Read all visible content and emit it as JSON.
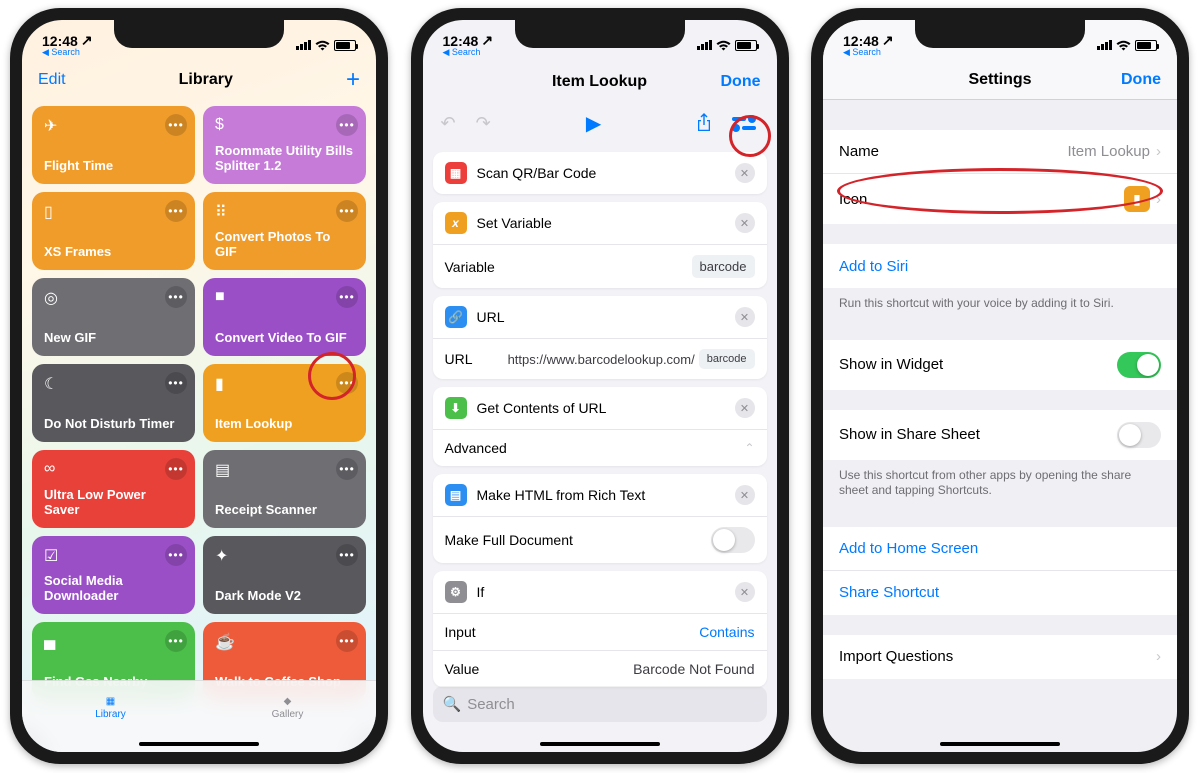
{
  "status": {
    "time": "12:48",
    "back_app": "Search"
  },
  "phone1": {
    "nav_edit": "Edit",
    "nav_title": "Library",
    "tiles": [
      {
        "title": "Flight Time",
        "color": "#f09c2a",
        "icon": "airplane"
      },
      {
        "title": "Roommate Utility Bills Splitter 1.2",
        "color": "#c67bd9",
        "icon": "dollar"
      },
      {
        "title": "XS Frames",
        "color": "#f09c2a",
        "icon": "phone"
      },
      {
        "title": "Convert Photos To GIF",
        "color": "#f09c2a",
        "icon": "grid"
      },
      {
        "title": "New GIF",
        "color": "#6e6e73",
        "icon": "target"
      },
      {
        "title": "Convert Video To GIF",
        "color": "#9a4fc7",
        "icon": "video"
      },
      {
        "title": "Do Not Disturb Timer",
        "color": "#58585d",
        "icon": "moon"
      },
      {
        "title": "Item Lookup",
        "color": "#f0a020",
        "icon": "barcode"
      },
      {
        "title": "Ultra Low Power Saver",
        "color": "#e7413a",
        "icon": "infinity"
      },
      {
        "title": "Receipt Scanner",
        "color": "#6e6e73",
        "icon": "document"
      },
      {
        "title": "Social Media Downloader",
        "color": "#9a4fc7",
        "icon": "checkbox"
      },
      {
        "title": "Dark Mode V2",
        "color": "#58585d",
        "icon": "wand"
      },
      {
        "title": "Find Gas Nearby",
        "color": "#4cbf4a",
        "icon": "car"
      },
      {
        "title": "Walk to Coffee Shop",
        "color": "#ee5b3a",
        "icon": "cup"
      }
    ],
    "tab_library": "Library",
    "tab_gallery": "Gallery"
  },
  "phone2": {
    "nav_title": "Item Lookup",
    "nav_done": "Done",
    "actions": {
      "scan": "Scan QR/Bar Code",
      "setvar": "Set Variable",
      "setvar_label": "Variable",
      "setvar_value": "barcode",
      "url": "URL",
      "url_label": "URL",
      "url_value": "https://www.barcodelookup.com/",
      "url_var": "barcode",
      "get_contents": "Get Contents of URL",
      "advanced": "Advanced",
      "make_html": "Make HTML from Rich Text",
      "make_full": "Make Full Document",
      "if": "If",
      "if_input": "Input",
      "if_cond": "Contains",
      "if_value_label": "Value",
      "if_value": "Barcode Not Found"
    },
    "search_placeholder": "Search"
  },
  "phone3": {
    "nav_title": "Settings",
    "nav_done": "Done",
    "name_label": "Name",
    "name_value": "Item Lookup",
    "icon_label": "Icon",
    "add_siri": "Add to Siri",
    "siri_hint": "Run this shortcut with your voice by adding it to Siri.",
    "show_widget": "Show in Widget",
    "show_share": "Show in Share Sheet",
    "share_hint": "Use this shortcut from other apps by opening the share sheet and tapping Shortcuts.",
    "add_home": "Add to Home Screen",
    "share_shortcut": "Share Shortcut",
    "import_q": "Import Questions"
  }
}
